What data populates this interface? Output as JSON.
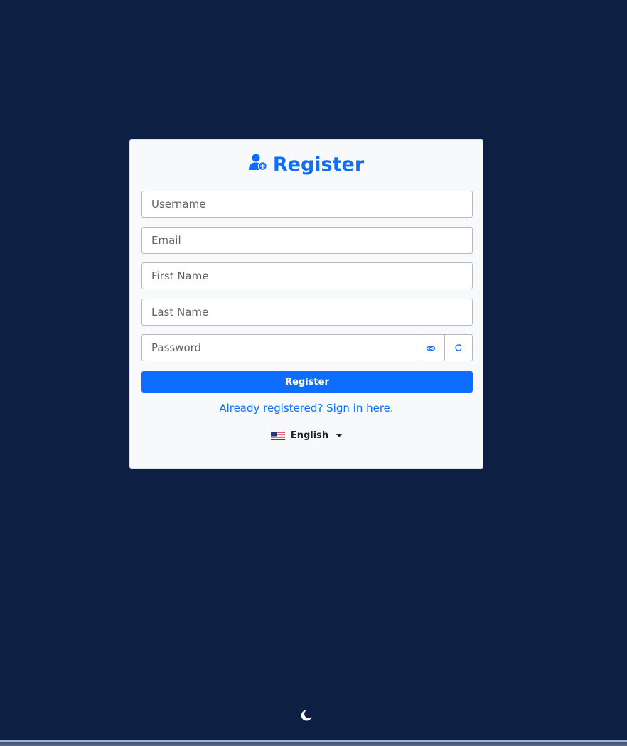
{
  "register_card": {
    "title": "Register",
    "title_icon": "user-plus-icon"
  },
  "form": {
    "username_placeholder": "Username",
    "email_placeholder": "Email",
    "first_name_placeholder": "First Name",
    "last_name_placeholder": "Last Name",
    "password_placeholder": "Password",
    "show_password_icon": "eye-icon",
    "generate_password_icon": "refresh-icon",
    "submit_label": "Register"
  },
  "signin_link": "Already registered? Sign in here.",
  "language": {
    "selected": "English",
    "flag_icon": "us-flag-icon"
  },
  "theme_toggle_icon": "moon-icon",
  "colors": {
    "background": "#0e1f44",
    "card": "#f8f9fa",
    "accent": "#0d6efd"
  }
}
